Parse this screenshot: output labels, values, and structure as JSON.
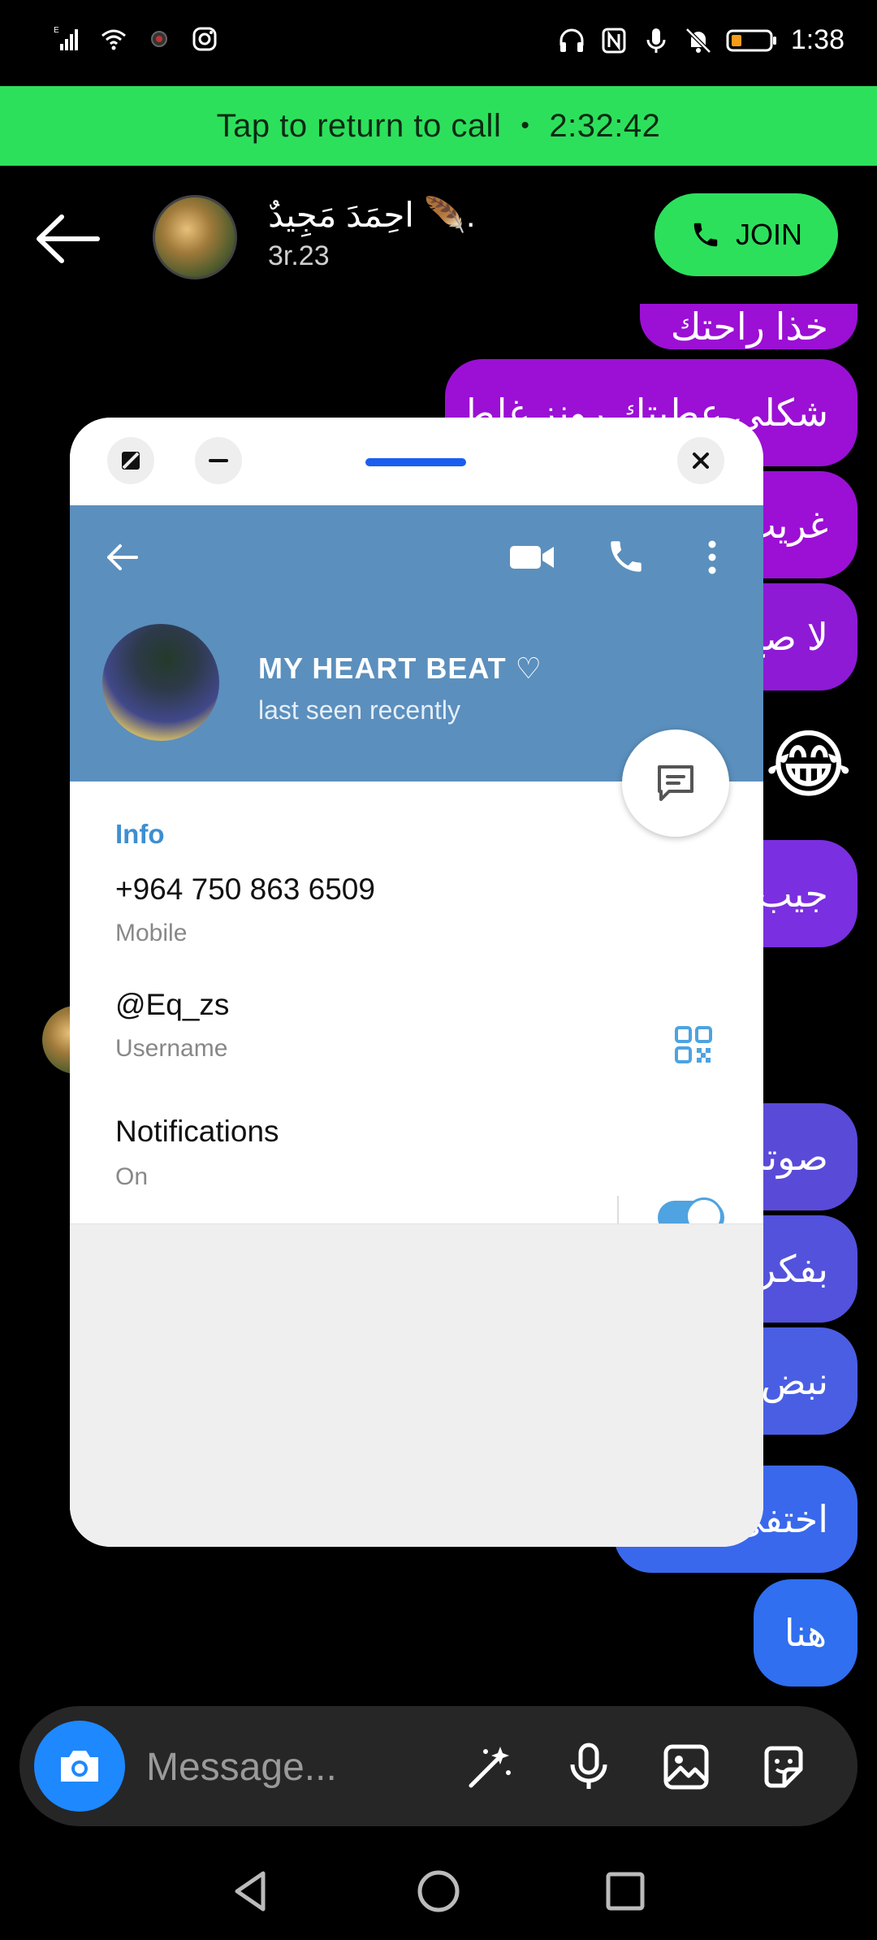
{
  "status_bar": {
    "time": "1:38",
    "network": "E"
  },
  "call_banner": {
    "label": "Tap to return to call",
    "separator": "•",
    "duration": "2:32:42"
  },
  "chat_header": {
    "name": "احِمَدَ مَجِيدٌ 🪶.",
    "subtitle": "3r.23",
    "join_label": "JOIN"
  },
  "bubbles": [
    {
      "text": "خذا راحتك"
    },
    {
      "text": "شكلي عطيتك رونز غلط"
    },
    {
      "text": "غريب"
    },
    {
      "text": "لا صح"
    },
    {
      "text": "جيب"
    },
    {
      "text": "صوتك"
    },
    {
      "text": "بفكرة"
    },
    {
      "text": "نبض"
    },
    {
      "text": "اختفى"
    },
    {
      "text": "هنا"
    }
  ],
  "emoji": "😂",
  "profile": {
    "name": "MY HEART BEAT ♡",
    "status": "last seen recently",
    "info_title": "Info",
    "phone": "+964 750 863 6509",
    "phone_label": "Mobile",
    "username": "@Eq_zs",
    "username_label": "Username",
    "notifications": "Notifications",
    "notifications_state": "On",
    "notifications_enabled": true
  },
  "composer": {
    "placeholder": "Message..."
  },
  "colors": {
    "call_green": "#2de05c",
    "header_blue": "#5b8fbd",
    "accent_blue": "#3d8fd1",
    "purple": "#9b10d4",
    "violet": "#7a2fe0",
    "indigo": "#5a4ad8",
    "blue": "#2f6ff0"
  }
}
